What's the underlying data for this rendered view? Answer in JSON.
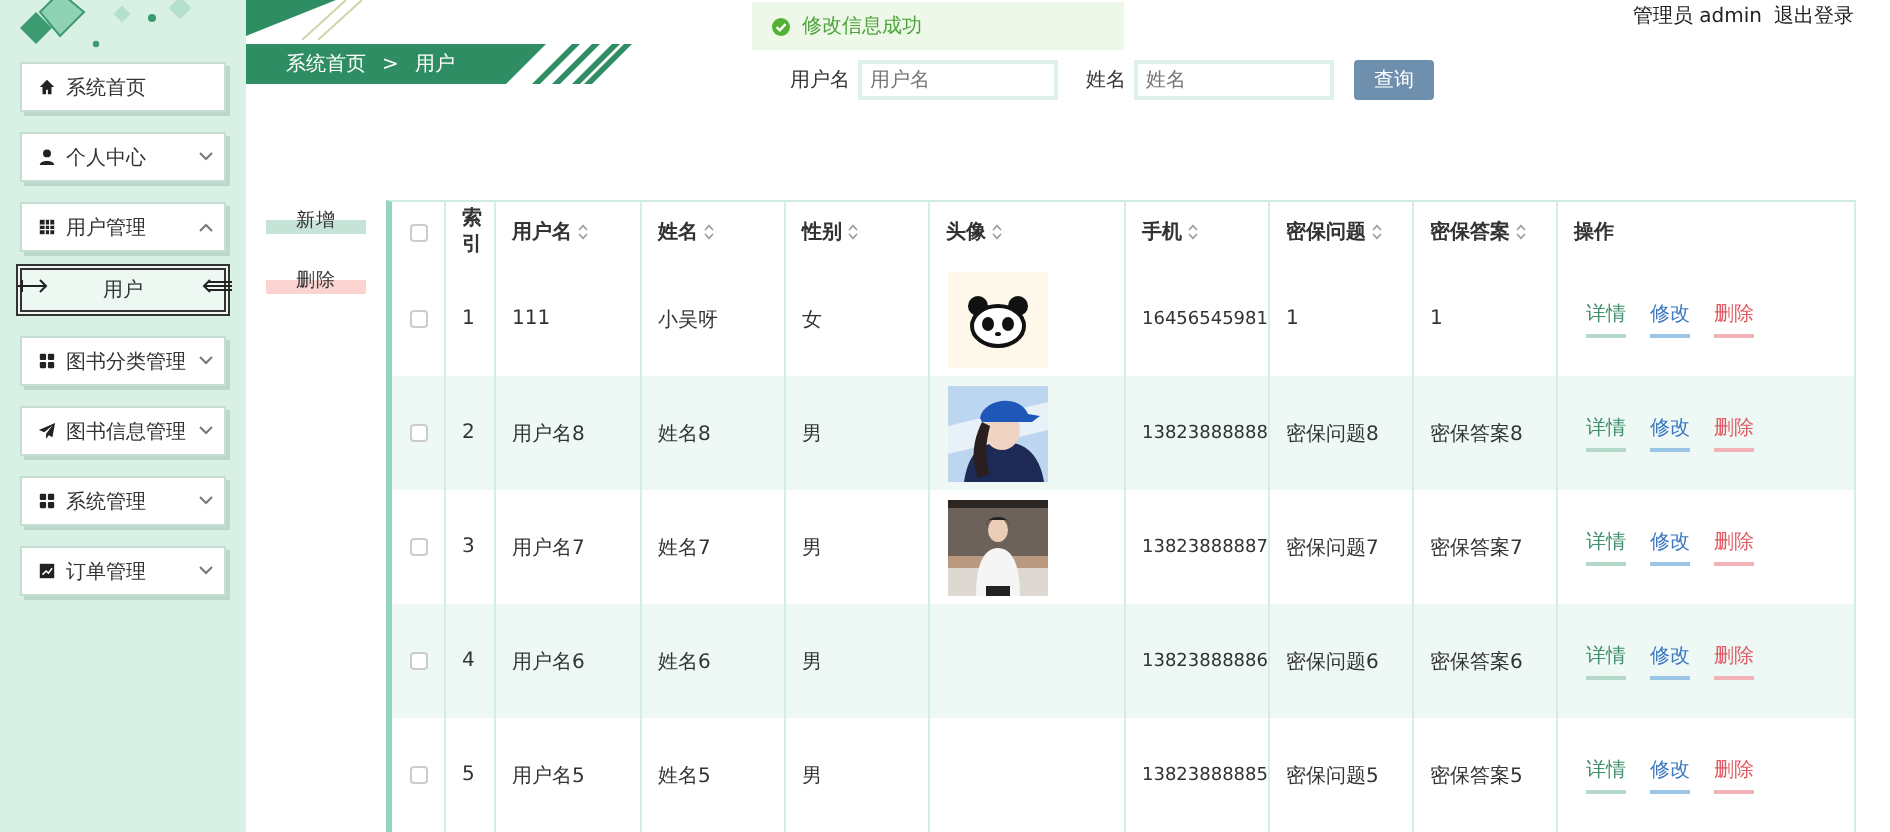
{
  "sidebar": {
    "items": [
      {
        "label": "系统首页",
        "kind": "home"
      },
      {
        "label": "个人中心",
        "kind": "user",
        "expanded": false
      },
      {
        "label": "用户管理",
        "kind": "table",
        "expanded": true,
        "children": [
          {
            "label": "用户",
            "selected": true
          }
        ]
      },
      {
        "label": "图书分类管理",
        "kind": "apps",
        "expanded": false
      },
      {
        "label": "图书信息管理",
        "kind": "send",
        "expanded": false
      },
      {
        "label": "系统管理",
        "kind": "apps",
        "expanded": false
      },
      {
        "label": "订单管理",
        "kind": "chart",
        "expanded": false
      }
    ]
  },
  "breadcrumb": {
    "items": [
      "系统首页",
      "用户"
    ],
    "separator": ">"
  },
  "toast": {
    "text": "修改信息成功"
  },
  "user": {
    "account": "管理员 admin",
    "logout": "退出登录"
  },
  "search": {
    "fields": [
      {
        "label": "用户名",
        "placeholder": "用户名"
      },
      {
        "label": "姓名",
        "placeholder": "姓名"
      }
    ],
    "button": "查询"
  },
  "actions": [
    {
      "label": "新增",
      "kind": "add"
    },
    {
      "label": "删除",
      "kind": "delete"
    }
  ],
  "table": {
    "select_all": {
      "checked": false
    },
    "columns": [
      {
        "label": "索引",
        "sortable": false
      },
      {
        "label": "用户名",
        "sortable": true
      },
      {
        "label": "姓名",
        "sortable": true
      },
      {
        "label": "性别",
        "sortable": true
      },
      {
        "label": "头像",
        "sortable": true
      },
      {
        "label": "手机",
        "sortable": true
      },
      {
        "label": "密保问题",
        "sortable": true
      },
      {
        "label": "密保答案",
        "sortable": true
      },
      {
        "label": "操作",
        "sortable": false
      }
    ],
    "rows": [
      {
        "checked": false,
        "index": "1",
        "username": "111",
        "name": "小吴呀",
        "gender": "女",
        "phone": "16456545981",
        "question": "1",
        "answer": "1",
        "actions": [
          {
            "label": "详情",
            "kind": "detail"
          },
          {
            "label": "修改",
            "kind": "edit"
          },
          {
            "label": "删除",
            "kind": "delete"
          }
        ]
      },
      {
        "checked": false,
        "index": "2",
        "username": "用户名8",
        "name": "姓名8",
        "gender": "男",
        "phone": "13823888888",
        "question": "密保问题8",
        "answer": "密保答案8",
        "actions": [
          {
            "label": "详情",
            "kind": "detail"
          },
          {
            "label": "修改",
            "kind": "edit"
          },
          {
            "label": "删除",
            "kind": "delete"
          }
        ]
      },
      {
        "checked": false,
        "index": "3",
        "username": "用户名7",
        "name": "姓名7",
        "gender": "男",
        "phone": "13823888887",
        "question": "密保问题7",
        "answer": "密保答案7",
        "actions": [
          {
            "label": "详情",
            "kind": "detail"
          },
          {
            "label": "修改",
            "kind": "edit"
          },
          {
            "label": "删除",
            "kind": "delete"
          }
        ]
      },
      {
        "checked": false,
        "index": "4",
        "username": "用户名6",
        "name": "姓名6",
        "gender": "男",
        "phone": "13823888886",
        "question": "密保问题6",
        "answer": "密保答案6",
        "actions": [
          {
            "label": "详情",
            "kind": "detail"
          },
          {
            "label": "修改",
            "kind": "edit"
          },
          {
            "label": "删除",
            "kind": "delete"
          }
        ]
      },
      {
        "checked": false,
        "index": "5",
        "username": "用户名5",
        "name": "姓名5",
        "gender": "男",
        "phone": "13823888885",
        "question": "密保问题5",
        "answer": "密保答案5",
        "actions": [
          {
            "label": "详情",
            "kind": "detail"
          },
          {
            "label": "修改",
            "kind": "edit"
          },
          {
            "label": "删除",
            "kind": "delete"
          }
        ]
      }
    ]
  }
}
